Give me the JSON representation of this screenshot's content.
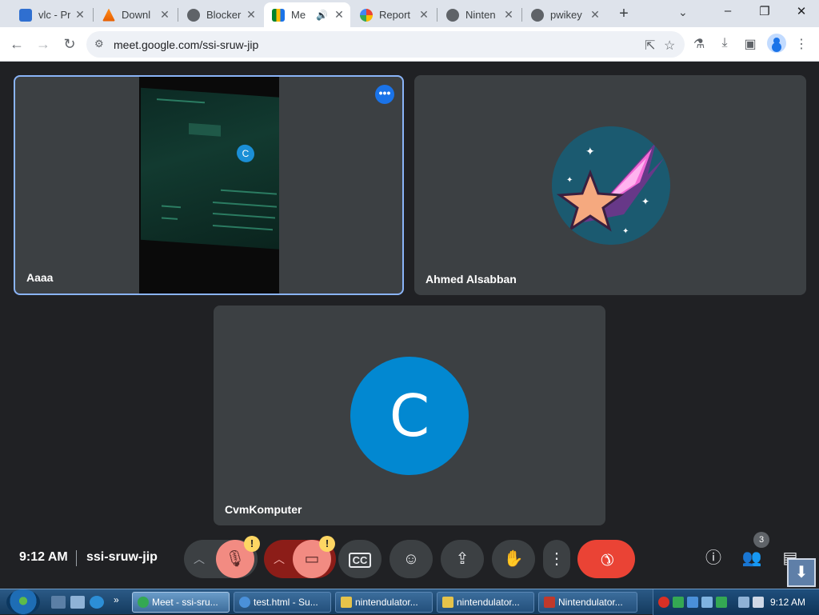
{
  "browser": {
    "tabs": [
      {
        "title": "vlc - Pr",
        "favicon": "document-icon",
        "active": false
      },
      {
        "title": "Downl",
        "favicon": "vlc-cone-icon",
        "active": false
      },
      {
        "title": "Blocker",
        "favicon": "globe-icon",
        "active": false
      },
      {
        "title": "Me",
        "favicon": "google-meet-icon",
        "active": true,
        "audio": true
      },
      {
        "title": "Report",
        "favicon": "google-icon",
        "active": false
      },
      {
        "title": "Ninten",
        "favicon": "globe-icon",
        "active": false
      },
      {
        "title": "pwikey",
        "favicon": "globe-icon",
        "active": false
      }
    ],
    "url": "meet.google.com/ssi-sruw-jip"
  },
  "meet": {
    "tiles": [
      {
        "name": "Aaaa",
        "kind": "video",
        "selected": true
      },
      {
        "name": "Ahmed Alsabban",
        "kind": "avatar-image"
      },
      {
        "name": "CvmKomputer",
        "kind": "initial",
        "initial": "C",
        "initial_color": "#0288d1"
      }
    ],
    "shared_screen_initial": "C",
    "time": "9:12 AM",
    "meeting_code": "ssi-sruw-jip",
    "people_count": "3",
    "warning_mark": "!",
    "colors": {
      "end_call": "#ea4335",
      "muted": "#f28b82",
      "warning": "#fdd663",
      "selected_border": "#8ab4f8"
    }
  },
  "taskbar": {
    "buttons": [
      {
        "label": "Meet - ssi-sru...",
        "active": true
      },
      {
        "label": "test.html - Su...",
        "active": false
      },
      {
        "label": "nintendulator...",
        "active": false
      },
      {
        "label": "nintendulator...",
        "active": false
      },
      {
        "label": "Nintendulator...",
        "active": false
      }
    ],
    "clock": "9:12 AM"
  }
}
